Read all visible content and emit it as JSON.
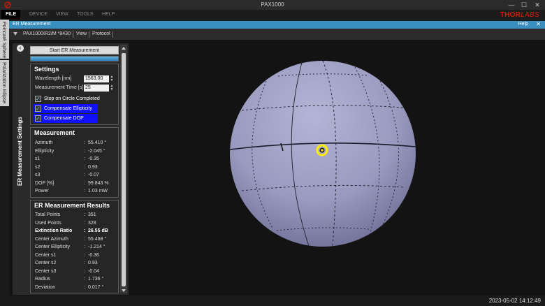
{
  "window": {
    "title": "PAX1000",
    "minimize": "—",
    "maximize": "☐",
    "close": "✕"
  },
  "menu": {
    "items": [
      "FILE",
      "DEVICE",
      "VIEW",
      "TOOLS",
      "HELP"
    ],
    "brand_main": "THOR",
    "brand_sub": "LABS"
  },
  "side_tabs": [
    "Poincaré Sphere",
    "Polarization Ellipse"
  ],
  "panel": {
    "title": "ER Measurement",
    "help": "Help",
    "close": "✕"
  },
  "device_bar": {
    "device": "PAX1000IR2/M *8430",
    "view": "View",
    "protocol": "Protocol"
  },
  "left": {
    "vertical_title": "ER Measurement Settings",
    "back_icon": "‹",
    "start_button": "Start ER Measurement",
    "progress": 1.0
  },
  "settings": {
    "title": "Settings",
    "wavelength_label": "Wavelength [nm]",
    "wavelength_value": "1563.00",
    "meas_time_label": "Measurement Time [s]",
    "meas_time_value": "25",
    "checkboxes": [
      {
        "label": "Stop on Circle Completed",
        "checked": true
      },
      {
        "label": "Compensate Ellipticity",
        "checked": true
      },
      {
        "label": "Compensate DOP",
        "checked": true
      }
    ]
  },
  "measurement": {
    "title": "Measurement",
    "rows": [
      {
        "label": "Azimuth",
        "value": "55.410 °"
      },
      {
        "label": "Ellipticity",
        "value": "-2.045 °"
      },
      {
        "label": "s1",
        "value": "-0.35"
      },
      {
        "label": "s2",
        "value": "0.93"
      },
      {
        "label": "s3",
        "value": "-0.07"
      },
      {
        "label": "DOP [%]",
        "value": "99.843 %"
      },
      {
        "label": "Power",
        "value": "1.03 mW"
      }
    ]
  },
  "results": {
    "title": "ER Measurement Results",
    "rows": [
      {
        "label": "Total Points",
        "value": "351"
      },
      {
        "label": "Used Points",
        "value": "328"
      },
      {
        "label": "Extinction Ratio",
        "value": "26.55 dB"
      },
      {
        "label": "Center Azimuth",
        "value": "55.468 °"
      },
      {
        "label": "Center Ellipticity",
        "value": "-1.214 °"
      },
      {
        "label": "Center s1",
        "value": "-0.36"
      },
      {
        "label": "Center s2",
        "value": "0.93"
      },
      {
        "label": "Center s3",
        "value": "-0.04"
      },
      {
        "label": "Radius",
        "value": "1.736 °"
      },
      {
        "label": "Deviation",
        "value": "0.017 °"
      }
    ]
  },
  "colors": {
    "accent": "#3a8fc1",
    "brand": "#d81e05",
    "sphere": "#9a9ac0",
    "marker": "#ffee00",
    "highlight": "#1010ff"
  },
  "status": {
    "timestamp": "2023-05-02 14:12:49"
  }
}
